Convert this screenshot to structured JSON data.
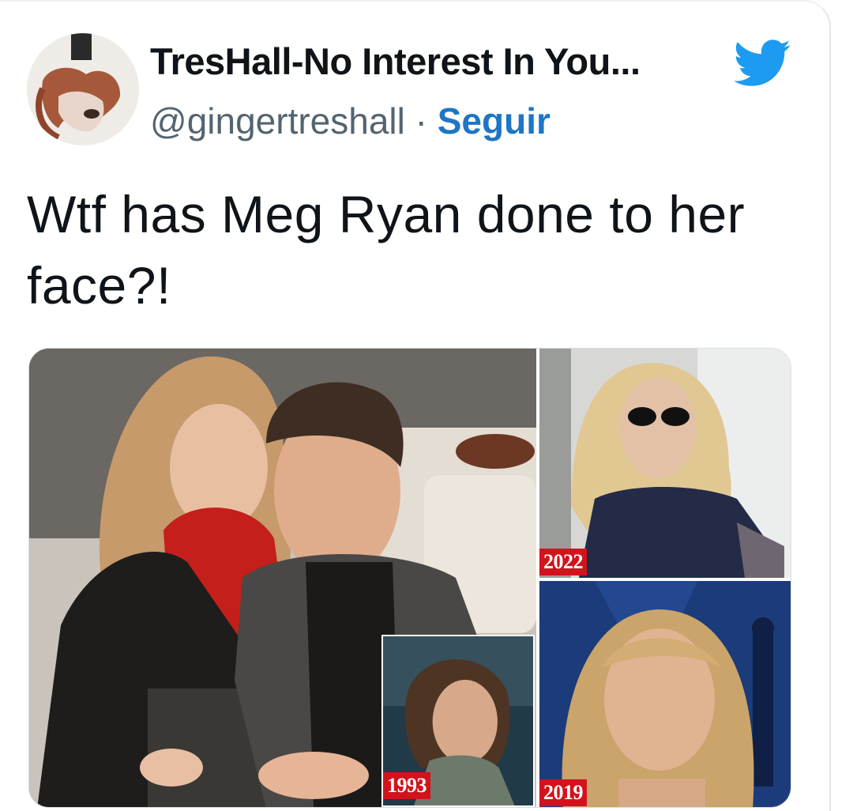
{
  "tweet": {
    "author": {
      "display_name": "TresHall-No Interest In You...",
      "handle": "@gingertreshall",
      "separator": "·",
      "follow_label": "Seguir"
    },
    "text": "Wtf has Meg Ryan done to her face?!",
    "media": {
      "badges": {
        "top_right": "2022",
        "inset": "1993",
        "bottom_right": "2019"
      }
    }
  },
  "icons": {
    "platform": "bird-icon",
    "accent": "#1d9bf0"
  },
  "colors": {
    "follow": "#1d76c6",
    "handle": "#536471",
    "badge": "#d3131c"
  }
}
